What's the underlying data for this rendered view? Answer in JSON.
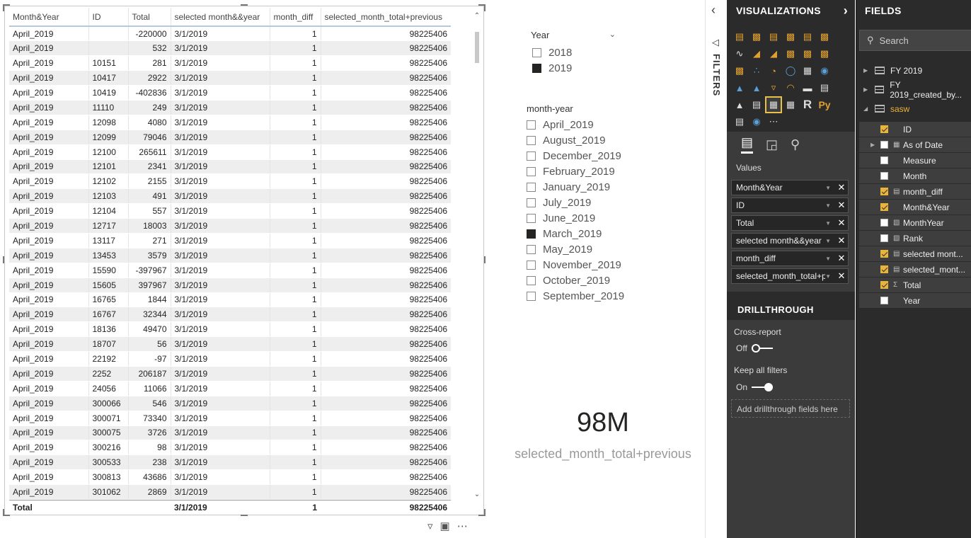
{
  "table": {
    "headers": [
      "Month&Year",
      "ID",
      "Total",
      "selected month&&year",
      "month_diff",
      "selected_month_total+previous"
    ],
    "rows": [
      [
        "April_2019",
        "",
        "-220000",
        "3/1/2019",
        "1",
        "98225406"
      ],
      [
        "April_2019",
        "",
        "532",
        "3/1/2019",
        "1",
        "98225406"
      ],
      [
        "April_2019",
        "10151",
        "281",
        "3/1/2019",
        "1",
        "98225406"
      ],
      [
        "April_2019",
        "10417",
        "2922",
        "3/1/2019",
        "1",
        "98225406"
      ],
      [
        "April_2019",
        "10419",
        "-402836",
        "3/1/2019",
        "1",
        "98225406"
      ],
      [
        "April_2019",
        "11110",
        "249",
        "3/1/2019",
        "1",
        "98225406"
      ],
      [
        "April_2019",
        "12098",
        "4080",
        "3/1/2019",
        "1",
        "98225406"
      ],
      [
        "April_2019",
        "12099",
        "79046",
        "3/1/2019",
        "1",
        "98225406"
      ],
      [
        "April_2019",
        "12100",
        "265611",
        "3/1/2019",
        "1",
        "98225406"
      ],
      [
        "April_2019",
        "12101",
        "2341",
        "3/1/2019",
        "1",
        "98225406"
      ],
      [
        "April_2019",
        "12102",
        "2155",
        "3/1/2019",
        "1",
        "98225406"
      ],
      [
        "April_2019",
        "12103",
        "491",
        "3/1/2019",
        "1",
        "98225406"
      ],
      [
        "April_2019",
        "12104",
        "557",
        "3/1/2019",
        "1",
        "98225406"
      ],
      [
        "April_2019",
        "12717",
        "18003",
        "3/1/2019",
        "1",
        "98225406"
      ],
      [
        "April_2019",
        "13117",
        "271",
        "3/1/2019",
        "1",
        "98225406"
      ],
      [
        "April_2019",
        "13453",
        "3579",
        "3/1/2019",
        "1",
        "98225406"
      ],
      [
        "April_2019",
        "15590",
        "-397967",
        "3/1/2019",
        "1",
        "98225406"
      ],
      [
        "April_2019",
        "15605",
        "397967",
        "3/1/2019",
        "1",
        "98225406"
      ],
      [
        "April_2019",
        "16765",
        "1844",
        "3/1/2019",
        "1",
        "98225406"
      ],
      [
        "April_2019",
        "16767",
        "32344",
        "3/1/2019",
        "1",
        "98225406"
      ],
      [
        "April_2019",
        "18136",
        "49470",
        "3/1/2019",
        "1",
        "98225406"
      ],
      [
        "April_2019",
        "18707",
        "56",
        "3/1/2019",
        "1",
        "98225406"
      ],
      [
        "April_2019",
        "22192",
        "-97",
        "3/1/2019",
        "1",
        "98225406"
      ],
      [
        "April_2019",
        "2252",
        "206187",
        "3/1/2019",
        "1",
        "98225406"
      ],
      [
        "April_2019",
        "24056",
        "11066",
        "3/1/2019",
        "1",
        "98225406"
      ],
      [
        "April_2019",
        "300066",
        "546",
        "3/1/2019",
        "1",
        "98225406"
      ],
      [
        "April_2019",
        "300071",
        "73340",
        "3/1/2019",
        "1",
        "98225406"
      ],
      [
        "April_2019",
        "300075",
        "3726",
        "3/1/2019",
        "1",
        "98225406"
      ],
      [
        "April_2019",
        "300216",
        "98",
        "3/1/2019",
        "1",
        "98225406"
      ],
      [
        "April_2019",
        "300533",
        "238",
        "3/1/2019",
        "1",
        "98225406"
      ],
      [
        "April_2019",
        "300813",
        "43686",
        "3/1/2019",
        "1",
        "98225406"
      ],
      [
        "April_2019",
        "301062",
        "2869",
        "3/1/2019",
        "1",
        "98225406"
      ]
    ],
    "total": {
      "label": "Total",
      "selected": "3/1/2019",
      "month_diff": "1",
      "value": "98225406"
    }
  },
  "year_slicer": {
    "title": "Year",
    "items": [
      {
        "label": "2018",
        "checked": false
      },
      {
        "label": "2019",
        "checked": true
      }
    ]
  },
  "month_slicer": {
    "title": "month-year",
    "items": [
      {
        "label": "April_2019",
        "checked": false
      },
      {
        "label": "August_2019",
        "checked": false
      },
      {
        "label": "December_2019",
        "checked": false
      },
      {
        "label": "February_2019",
        "checked": false
      },
      {
        "label": "January_2019",
        "checked": false
      },
      {
        "label": "July_2019",
        "checked": false
      },
      {
        "label": "June_2019",
        "checked": false
      },
      {
        "label": "March_2019",
        "checked": true
      },
      {
        "label": "May_2019",
        "checked": false
      },
      {
        "label": "November_2019",
        "checked": false
      },
      {
        "label": "October_2019",
        "checked": false
      },
      {
        "label": "September_2019",
        "checked": false
      }
    ]
  },
  "card": {
    "value": "98M",
    "label": "selected_month_total+previous"
  },
  "filters": {
    "label": "FILTERS"
  },
  "visualizations": {
    "title": "VISUALIZATIONS",
    "values_label": "Values",
    "wells": [
      "Month&Year",
      "ID",
      "Total",
      "selected month&&year",
      "month_diff",
      "selected_month_total+p"
    ],
    "drillthrough_title": "DRILLTHROUGH",
    "cross_report_label": "Cross-report",
    "cross_report_state": "Off",
    "keep_filters_label": "Keep all filters",
    "keep_filters_state": "On",
    "drop_zone": "Add drillthrough fields here"
  },
  "fields": {
    "title": "FIELDS",
    "search_placeholder": "Search",
    "tables": [
      "FY 2019",
      "FY 2019_created_by...",
      "sasw"
    ],
    "items": [
      {
        "name": "ID",
        "checked": true,
        "type": ""
      },
      {
        "name": "As of Date",
        "checked": false,
        "type": "table",
        "expandable": true
      },
      {
        "name": "Measure",
        "checked": false,
        "type": ""
      },
      {
        "name": "Month",
        "checked": false,
        "type": ""
      },
      {
        "name": "month_diff",
        "checked": true,
        "type": "calc"
      },
      {
        "name": "Month&Year",
        "checked": true,
        "type": ""
      },
      {
        "name": "MonthYear",
        "checked": false,
        "type": "calc-col"
      },
      {
        "name": "Rank",
        "checked": false,
        "type": "calc-col"
      },
      {
        "name": "selected mont...",
        "checked": true,
        "type": "calc"
      },
      {
        "name": "selected_mont...",
        "checked": true,
        "type": "calc"
      },
      {
        "name": "Total",
        "checked": true,
        "type": "sigma"
      },
      {
        "name": "Year",
        "checked": false,
        "type": ""
      }
    ]
  },
  "colors": {
    "pane_bg": "#2b2b2b",
    "accent": "#e8b43a"
  }
}
